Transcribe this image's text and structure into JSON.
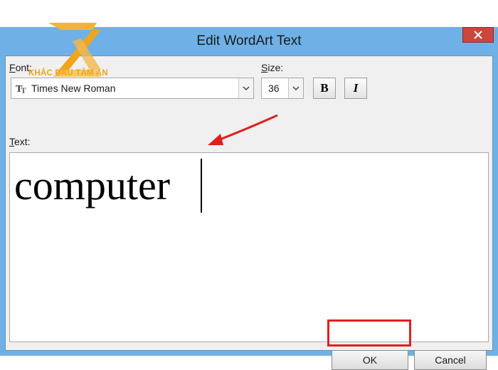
{
  "window": {
    "title": "Edit WordArt Text"
  },
  "font": {
    "label_accel": "F",
    "label_rest": "ont:",
    "value": "Times New Roman",
    "icon": "truetype-font-icon"
  },
  "size": {
    "label_accel": "S",
    "label_rest": "ize:",
    "value": "36"
  },
  "format": {
    "bold_label": "B",
    "italic_label": "I"
  },
  "text": {
    "label_accel": "T",
    "label_rest": "ext:",
    "value": "computer"
  },
  "buttons": {
    "ok": "OK",
    "cancel": "Cancel"
  },
  "watermark": {
    "brand": "KHẮC DẤU TÂM AN"
  },
  "colors": {
    "title_bar": "#6fb1e6",
    "close": "#c9473d",
    "highlight": "#e02020",
    "brand": "#f0a51c"
  }
}
